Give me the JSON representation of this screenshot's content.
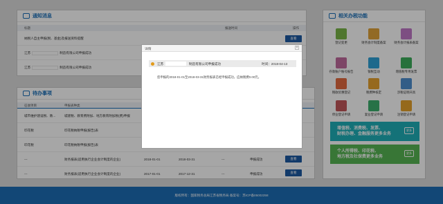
{
  "notice": {
    "title": "通知消息",
    "columns": [
      "标题",
      "报送时间",
      "操作"
    ],
    "rows": [
      {
        "prefix": "纳税人自主申报(税、基金)及报送资料提醒",
        "suffix": "",
        "action": "查看"
      },
      {
        "prefix": "江苏",
        "suffix": "制造有限公司申报成功",
        "action": "查看"
      },
      {
        "prefix": "江苏",
        "suffix": "制造有限公司申报成功",
        "action": "查看"
      }
    ]
  },
  "todo": {
    "title": "待办事项",
    "columns": [
      "征收项目",
      "申报表种类"
    ],
    "rows": [
      {
        "c1": "城市维护建设税、教...",
        "c2": "城建税、教育费附加、地方教育附加税(费)申报",
        "c3": "",
        "c4": "",
        "c5": "",
        "c6": "",
        "action": ""
      },
      {
        "c1": "印花税",
        "c2": "印花税纳税申报(报告)表",
        "c3": "",
        "c4": "",
        "c5": "",
        "c6": "",
        "action": ""
      },
      {
        "c1": "印花税",
        "c2": "印花税纳税申报(报告)表",
        "c3": "",
        "c4": "",
        "c5": "",
        "c6": "",
        "action": ""
      },
      {
        "c1": "---",
        "c2": "财务报表(适用执行企业会计制度的企业)",
        "c3": "2018-01-01",
        "c4": "2018-03-31",
        "c5": "---",
        "c6": "申报成功",
        "action": "查看"
      },
      {
        "c1": "---",
        "c2": "财务报表(适用执行企业会计制度的企业)",
        "c3": "2017-01-01",
        "c4": "2017-12-31",
        "c5": "---",
        "c6": "申报成功",
        "action": "查看"
      }
    ]
  },
  "functions": {
    "title": "相关办税功能",
    "items": [
      {
        "label": "登记变更",
        "icon": "register-icon",
        "color": "#7ab648"
      },
      {
        "label": "财务会计制度备案",
        "icon": "accounting-icon",
        "color": "#e0a33a"
      },
      {
        "label": "财务会计报表备案",
        "icon": "report-icon",
        "color": "#c178c8"
      },
      {
        "label": "存款账户账号报告",
        "icon": "bank-icon",
        "color": "#c06a9d"
      },
      {
        "label": "银税互动",
        "icon": "bank-tax-icon",
        "color": "#2ea2d8"
      },
      {
        "label": "增值税专用发票",
        "icon": "invoice-icon",
        "color": "#3cae5b"
      },
      {
        "label": "税收优惠登记",
        "icon": "discount-icon",
        "color": "#e46b40"
      },
      {
        "label": "税费种核定",
        "icon": "calendar-icon",
        "color": "#e7a12f"
      },
      {
        "label": "涉税证明开具",
        "icon": "certificate-icon",
        "color": "#4d8fd0"
      },
      {
        "label": "停业登记申请",
        "icon": "pause-icon",
        "color": "#c2575a"
      },
      {
        "label": "复业登记申请",
        "icon": "resume-icon",
        "color": "#3caf6e"
      },
      {
        "label": "注销登记申请",
        "icon": "cancel-icon",
        "color": "#e5a12c"
      }
    ],
    "banner1": {
      "line1": "增值税、消费税、发票、",
      "line2": "财税办理、金融服务更多业务",
      "tag": "更多"
    },
    "banner2": {
      "line1": "个人所得税、印花税、",
      "line2": "地方税及社保费更多业务",
      "tag": "更多"
    },
    "banner1_color": "#1fb0b9",
    "banner2_color": "#56b653"
  },
  "modal": {
    "title": "详情",
    "close": "×",
    "company_prefix": "江苏",
    "company_suffix": "制造有限公司申报成功",
    "time_label": "时间：2018-04-13",
    "message": "您申报的2018-01-01至2018-03-31财务报表已经申报成功，应纳税费0.00元。"
  },
  "footer": {
    "text": "版权所有：国家税务总局江苏省税务局   备案号：苏ICP备05002258"
  },
  "colors": {
    "accent": "#1a6fb8",
    "button": "#1d5aa3",
    "footer": "#1d6db6"
  }
}
